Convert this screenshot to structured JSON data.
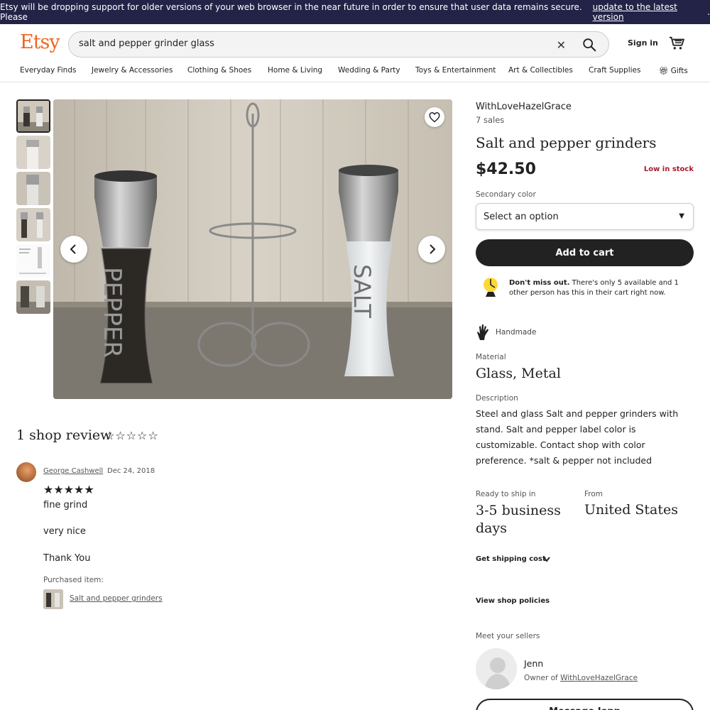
{
  "banner": {
    "text": "Etsy will be dropping support for older versions of your web browser in the near future in order to ensure that user data remains secure. Please ",
    "link": "update to the latest version",
    "tail": "."
  },
  "header": {
    "logo": "Etsy",
    "search_value": "salt and pepper grinder glass",
    "sign_in": "Sign in"
  },
  "nav": {
    "items": [
      "Everyday Finds",
      "Jewelry & Accessories",
      "Clothing & Shoes",
      "Home & Living",
      "Wedding & Party",
      "Toys & Entertainment",
      "Art & Collectibles",
      "Craft Supplies",
      "Gifts"
    ]
  },
  "reviews": {
    "title": "1 shop review",
    "empty_stars": "☆☆☆☆☆",
    "review": {
      "name": "George Cashwell",
      "date": "Dec 24, 2018",
      "stars": "★★★★★",
      "lines": [
        "fine grind",
        "very nice",
        "Thank You"
      ],
      "purchased_label": "Purchased item:",
      "purchased_item": "Salt and pepper grinders"
    }
  },
  "listing": {
    "shop_name": "WithLoveHazelGrace",
    "sales": "7 sales",
    "title": "Salt and pepper grinders",
    "price": "$42.50",
    "stock": "Low in stock",
    "secondary_color_label": "Secondary color",
    "select_placeholder": "Select an option",
    "add_to_cart": "Add to cart",
    "dont_miss_bold": "Don't miss out.",
    "dont_miss_text": " There's only 5 available and 1 other person has this in their cart right now.",
    "handmade": "Handmade",
    "material_label": "Material",
    "material": "Glass, Metal",
    "description_label": "Description",
    "description": "Steel and glass Salt and pepper grinders with stand. Salt and pepper label color is customizable. Contact shop with color preference. *salt & pepper not included",
    "ready_label": "Ready to ship in",
    "ready_value": "3-5 business days",
    "from_label": "From",
    "from_value": "United States",
    "shipping_cost": "Get shipping cost",
    "shop_policies": "View shop policies",
    "meet_sellers": "Meet your sellers",
    "seller_name": "Jenn",
    "owner_of": "Owner of ",
    "owner_shop": "WithLoveHazelGrace",
    "message_button": "Message Jenn"
  },
  "image_labels": {
    "pepper": "PEPPER",
    "salt": "SALT"
  },
  "colors": {
    "brand": "#f1641e",
    "banner_bg": "#232347",
    "stock_red": "#a61a2e"
  }
}
